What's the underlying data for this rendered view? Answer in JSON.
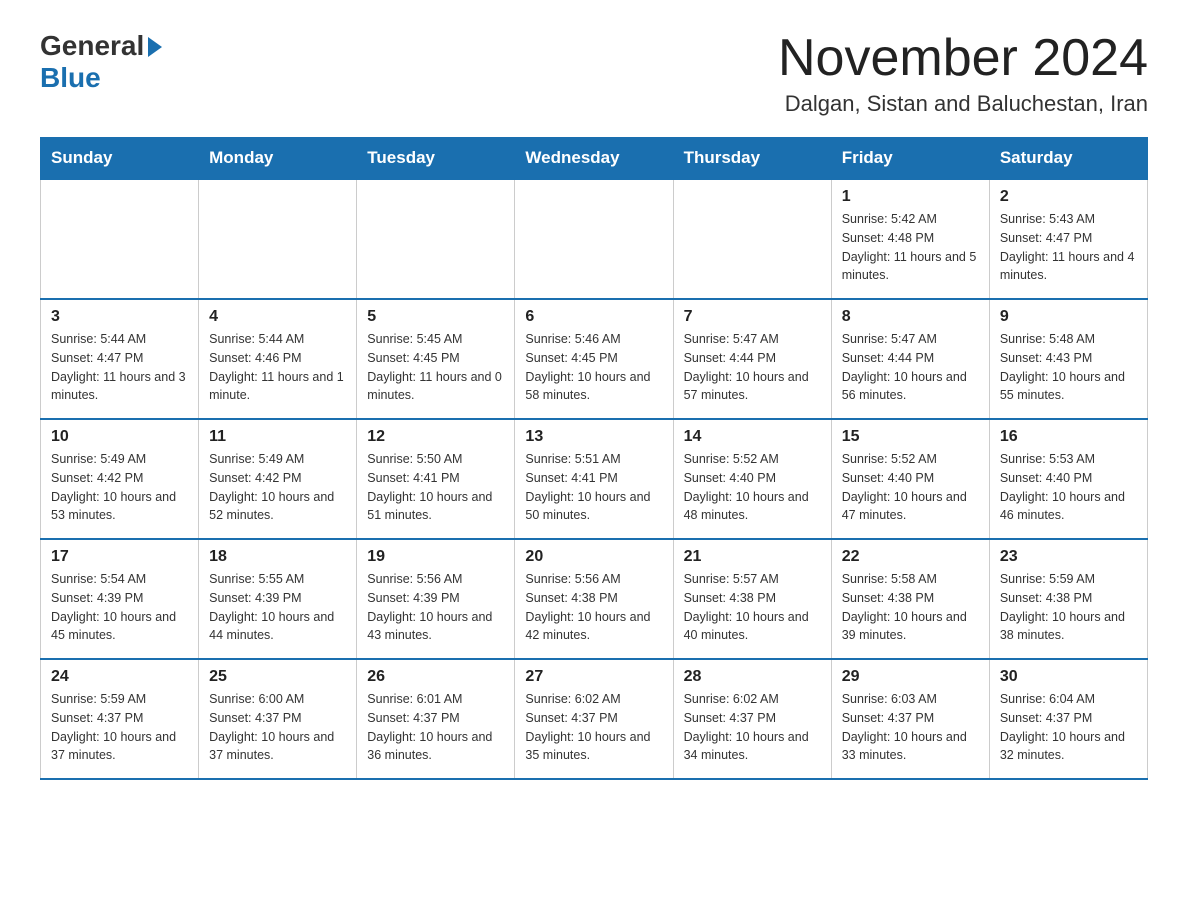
{
  "header": {
    "logo_general": "General",
    "logo_blue": "Blue",
    "main_title": "November 2024",
    "subtitle": "Dalgan, Sistan and Baluchestan, Iran"
  },
  "weekdays": [
    "Sunday",
    "Monday",
    "Tuesday",
    "Wednesday",
    "Thursday",
    "Friday",
    "Saturday"
  ],
  "weeks": [
    [
      {
        "day": "",
        "info": ""
      },
      {
        "day": "",
        "info": ""
      },
      {
        "day": "",
        "info": ""
      },
      {
        "day": "",
        "info": ""
      },
      {
        "day": "",
        "info": ""
      },
      {
        "day": "1",
        "info": "Sunrise: 5:42 AM\nSunset: 4:48 PM\nDaylight: 11 hours and 5 minutes."
      },
      {
        "day": "2",
        "info": "Sunrise: 5:43 AM\nSunset: 4:47 PM\nDaylight: 11 hours and 4 minutes."
      }
    ],
    [
      {
        "day": "3",
        "info": "Sunrise: 5:44 AM\nSunset: 4:47 PM\nDaylight: 11 hours and 3 minutes."
      },
      {
        "day": "4",
        "info": "Sunrise: 5:44 AM\nSunset: 4:46 PM\nDaylight: 11 hours and 1 minute."
      },
      {
        "day": "5",
        "info": "Sunrise: 5:45 AM\nSunset: 4:45 PM\nDaylight: 11 hours and 0 minutes."
      },
      {
        "day": "6",
        "info": "Sunrise: 5:46 AM\nSunset: 4:45 PM\nDaylight: 10 hours and 58 minutes."
      },
      {
        "day": "7",
        "info": "Sunrise: 5:47 AM\nSunset: 4:44 PM\nDaylight: 10 hours and 57 minutes."
      },
      {
        "day": "8",
        "info": "Sunrise: 5:47 AM\nSunset: 4:44 PM\nDaylight: 10 hours and 56 minutes."
      },
      {
        "day": "9",
        "info": "Sunrise: 5:48 AM\nSunset: 4:43 PM\nDaylight: 10 hours and 55 minutes."
      }
    ],
    [
      {
        "day": "10",
        "info": "Sunrise: 5:49 AM\nSunset: 4:42 PM\nDaylight: 10 hours and 53 minutes."
      },
      {
        "day": "11",
        "info": "Sunrise: 5:49 AM\nSunset: 4:42 PM\nDaylight: 10 hours and 52 minutes."
      },
      {
        "day": "12",
        "info": "Sunrise: 5:50 AM\nSunset: 4:41 PM\nDaylight: 10 hours and 51 minutes."
      },
      {
        "day": "13",
        "info": "Sunrise: 5:51 AM\nSunset: 4:41 PM\nDaylight: 10 hours and 50 minutes."
      },
      {
        "day": "14",
        "info": "Sunrise: 5:52 AM\nSunset: 4:40 PM\nDaylight: 10 hours and 48 minutes."
      },
      {
        "day": "15",
        "info": "Sunrise: 5:52 AM\nSunset: 4:40 PM\nDaylight: 10 hours and 47 minutes."
      },
      {
        "day": "16",
        "info": "Sunrise: 5:53 AM\nSunset: 4:40 PM\nDaylight: 10 hours and 46 minutes."
      }
    ],
    [
      {
        "day": "17",
        "info": "Sunrise: 5:54 AM\nSunset: 4:39 PM\nDaylight: 10 hours and 45 minutes."
      },
      {
        "day": "18",
        "info": "Sunrise: 5:55 AM\nSunset: 4:39 PM\nDaylight: 10 hours and 44 minutes."
      },
      {
        "day": "19",
        "info": "Sunrise: 5:56 AM\nSunset: 4:39 PM\nDaylight: 10 hours and 43 minutes."
      },
      {
        "day": "20",
        "info": "Sunrise: 5:56 AM\nSunset: 4:38 PM\nDaylight: 10 hours and 42 minutes."
      },
      {
        "day": "21",
        "info": "Sunrise: 5:57 AM\nSunset: 4:38 PM\nDaylight: 10 hours and 40 minutes."
      },
      {
        "day": "22",
        "info": "Sunrise: 5:58 AM\nSunset: 4:38 PM\nDaylight: 10 hours and 39 minutes."
      },
      {
        "day": "23",
        "info": "Sunrise: 5:59 AM\nSunset: 4:38 PM\nDaylight: 10 hours and 38 minutes."
      }
    ],
    [
      {
        "day": "24",
        "info": "Sunrise: 5:59 AM\nSunset: 4:37 PM\nDaylight: 10 hours and 37 minutes."
      },
      {
        "day": "25",
        "info": "Sunrise: 6:00 AM\nSunset: 4:37 PM\nDaylight: 10 hours and 37 minutes."
      },
      {
        "day": "26",
        "info": "Sunrise: 6:01 AM\nSunset: 4:37 PM\nDaylight: 10 hours and 36 minutes."
      },
      {
        "day": "27",
        "info": "Sunrise: 6:02 AM\nSunset: 4:37 PM\nDaylight: 10 hours and 35 minutes."
      },
      {
        "day": "28",
        "info": "Sunrise: 6:02 AM\nSunset: 4:37 PM\nDaylight: 10 hours and 34 minutes."
      },
      {
        "day": "29",
        "info": "Sunrise: 6:03 AM\nSunset: 4:37 PM\nDaylight: 10 hours and 33 minutes."
      },
      {
        "day": "30",
        "info": "Sunrise: 6:04 AM\nSunset: 4:37 PM\nDaylight: 10 hours and 32 minutes."
      }
    ]
  ]
}
